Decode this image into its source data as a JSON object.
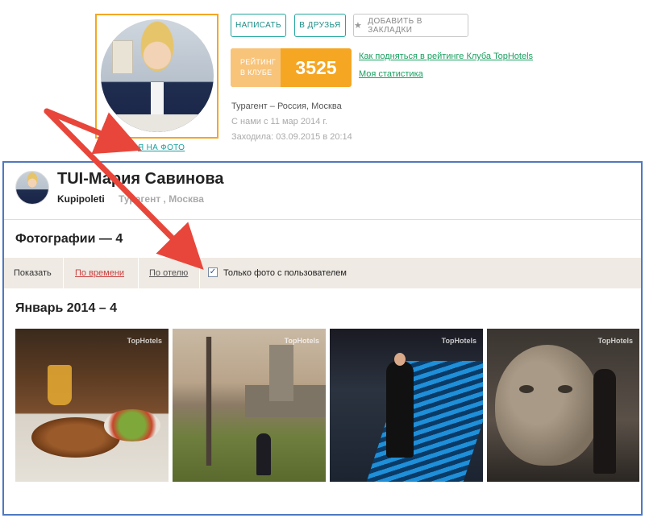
{
  "profile": {
    "me_on_photo_link": "Я НА ФОТО",
    "buttons": {
      "write": "НАПИСАТЬ",
      "friend": "В ДРУЗЬЯ",
      "bookmark": "ДОБАВИТЬ В ЗАКЛАДКИ"
    },
    "rating": {
      "label_line1": "РЕЙТИНГ",
      "label_line2": "В КЛУБЕ",
      "value": "3525"
    },
    "links": {
      "how_to_rise": "Как подняться в рейтинге Клуба TopHotels",
      "my_stats": "Моя статистика"
    },
    "info": {
      "role": "Турагент – Россия, Москва",
      "member_since": "С нами с 11 мар 2014 г.",
      "last_visit": "Заходила: 03.09.2015 в 20:14"
    }
  },
  "page": {
    "user_name": "TUI-Мария Савинова",
    "company": "Kupipoleti",
    "subtitle": "Турагент , Москва",
    "photos_title": "Фотографии — 4",
    "filter": {
      "show_label": "Показать",
      "by_time": "По времени",
      "by_hotel": "По отелю",
      "only_with_user": "Только фото с пользователем",
      "only_with_user_checked": true
    },
    "month_title": "Январь 2014 – 4",
    "photos": [
      {
        "watermark": "TopHotels"
      },
      {
        "watermark": "TopHotels"
      },
      {
        "watermark": "TopHotels"
      },
      {
        "watermark": "TopHotels"
      }
    ]
  },
  "colors": {
    "accent_orange": "#f5a623",
    "teal": "#1b8f89",
    "green_link": "#1aa060",
    "red_link": "#c84040",
    "frame_blue": "#4f79c0",
    "arrow_red": "#e8463a"
  }
}
